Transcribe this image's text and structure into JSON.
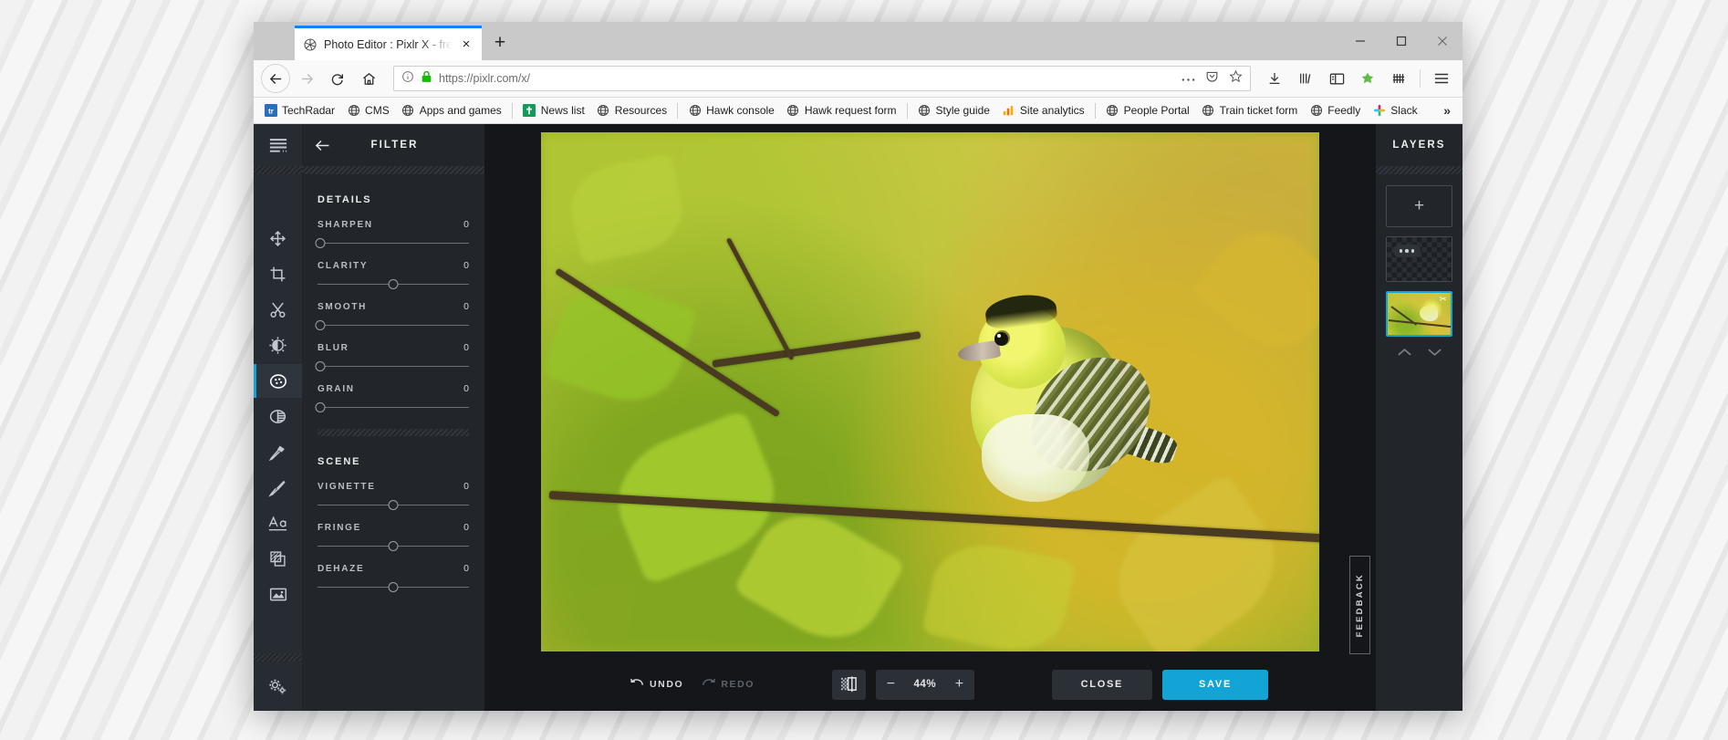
{
  "browser": {
    "tab": {
      "title": "Photo Editor : Pixlr X - free ima",
      "favicon": "pixlr-aperture-icon",
      "close": "×"
    },
    "newtab_label": "+",
    "window_controls": [
      "minimize",
      "maximize",
      "close"
    ],
    "nav": {
      "back": "back-arrow",
      "forward": "forward-arrow",
      "reload": "reload",
      "home": "home"
    },
    "url": {
      "identity_icon": "info-icon",
      "lock_icon": "green-padlock",
      "scheme": "https://",
      "host": "pixlr.com",
      "path": "/x/",
      "full": "https://pixlr.com/x/"
    },
    "url_actions": [
      "page-actions-ellipsis",
      "pocket-save",
      "bookmark-star"
    ],
    "toolbar_icons": [
      "downloads",
      "library",
      "sidebar",
      "extension-green",
      "extension-bars",
      "app-menu"
    ],
    "bookmarks": [
      {
        "label": "TechRadar",
        "icon": "techradar-tr-icon"
      },
      {
        "label": "CMS",
        "icon": "globe-icon"
      },
      {
        "label": "Apps and games",
        "icon": "globe-icon"
      },
      {
        "label": "News list",
        "icon": "evernote-icon",
        "sep_before": true
      },
      {
        "label": "Resources",
        "icon": "globe-icon"
      },
      {
        "label": "Hawk console",
        "icon": "globe-icon",
        "sep_before": true
      },
      {
        "label": "Hawk request form",
        "icon": "globe-icon"
      },
      {
        "label": "Style guide",
        "icon": "globe-icon",
        "sep_before": true
      },
      {
        "label": "Site analytics",
        "icon": "analytics-bars-icon"
      },
      {
        "label": "People Portal",
        "icon": "globe-icon",
        "sep_before": true
      },
      {
        "label": "Train ticket form",
        "icon": "globe-icon"
      },
      {
        "label": "Feedly",
        "icon": "globe-icon"
      },
      {
        "label": "Slack",
        "icon": "slack-icon"
      }
    ],
    "bookmarks_overflow": "»"
  },
  "app": {
    "rail": {
      "menu_label": "hamburger-menu",
      "tools": [
        {
          "name": "arrange",
          "icon": "move-arrows-icon"
        },
        {
          "name": "crop",
          "icon": "crop-icon"
        },
        {
          "name": "cutout",
          "icon": "scissors-icon"
        },
        {
          "name": "adjust",
          "icon": "contrast-sun-icon"
        },
        {
          "name": "filter",
          "icon": "filter-dots-icon",
          "active": true
        },
        {
          "name": "effect",
          "icon": "half-circle-icon"
        },
        {
          "name": "retouch",
          "icon": "retouch-tool-icon"
        },
        {
          "name": "draw",
          "icon": "paintbrush-icon"
        },
        {
          "name": "text",
          "icon": "text-aa-icon"
        },
        {
          "name": "element",
          "icon": "layers-pattern-icon"
        },
        {
          "name": "add-image",
          "icon": "picture-icon"
        }
      ],
      "settings_icon": "gears-icon"
    },
    "panel": {
      "back_icon": "back-arrow-icon",
      "title": "FILTER",
      "sections": [
        {
          "title": "DETAILS",
          "controls": [
            {
              "label": "SHARPEN",
              "value": "0",
              "knob_pct": 2
            },
            {
              "label": "CLARITY",
              "value": "0",
              "knob_pct": 50
            },
            {
              "label": "SMOOTH",
              "value": "0",
              "knob_pct": 2
            },
            {
              "label": "BLUR",
              "value": "0",
              "knob_pct": 2
            },
            {
              "label": "GRAIN",
              "value": "0",
              "knob_pct": 2
            }
          ]
        },
        {
          "title": "SCENE",
          "controls": [
            {
              "label": "VIGNETTE",
              "value": "0",
              "knob_pct": 50
            },
            {
              "label": "FRINGE",
              "value": "0",
              "knob_pct": 50
            },
            {
              "label": "DEHAZE",
              "value": "0",
              "knob_pct": 50
            }
          ]
        }
      ]
    },
    "canvas": {
      "image_alt": "eurasian-siskin-bird-on-branch-autumn-leaves"
    },
    "bottombar": {
      "undo_label": "UNDO",
      "undo_icon": "undo-arrow-icon",
      "redo_label": "REDO",
      "redo_icon": "redo-arrow-icon",
      "redo_disabled": true,
      "transparency_icon": "transparency-toggle-icon",
      "zoom_out": "−",
      "zoom_value": "44%",
      "zoom_in": "+",
      "close_label": "CLOSE",
      "save_label": "SAVE"
    },
    "layers": {
      "title": "LAYERS",
      "add_label": "+",
      "items": [
        {
          "type": "empty-transparent-layer",
          "icon": "three-dots-icon"
        },
        {
          "type": "photo-layer",
          "selected": true,
          "icon": "scissors-icon"
        }
      ],
      "move_up_icon": "chevron-up-icon",
      "move_down_icon": "chevron-down-icon"
    },
    "feedback_label": "FEEDBACK",
    "colors": {
      "accent": "#12a4d4",
      "panel_bg": "#22262b",
      "stage_bg": "#141619",
      "rail_bg": "#272c33"
    }
  }
}
